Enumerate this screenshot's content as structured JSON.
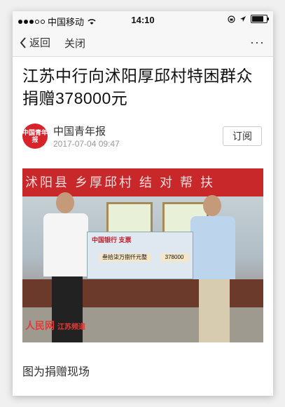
{
  "status_bar": {
    "carrier": "中国移动",
    "time": "14:10"
  },
  "nav": {
    "back_label": "返回",
    "close_label": "关闭",
    "more_label": "···"
  },
  "article": {
    "title": "江苏中行向沭阳厚邱村特困群众捐赠378000元",
    "source_name": "中国青年报",
    "source_logo_text": "中国青年报",
    "date": "2017-07-04 09:47",
    "follow_label": "订阅",
    "photo": {
      "banner_text": "沭阳县 乡厚邱村 结 对 帮 扶",
      "check_bank": "中国银行 支票",
      "check_amount_cn": "叁拾柒万捌仟元整",
      "check_amount_num": "378000",
      "watermark": "人民网",
      "watermark_sub": "江苏频道"
    },
    "caption": "图为捐赠现场"
  }
}
